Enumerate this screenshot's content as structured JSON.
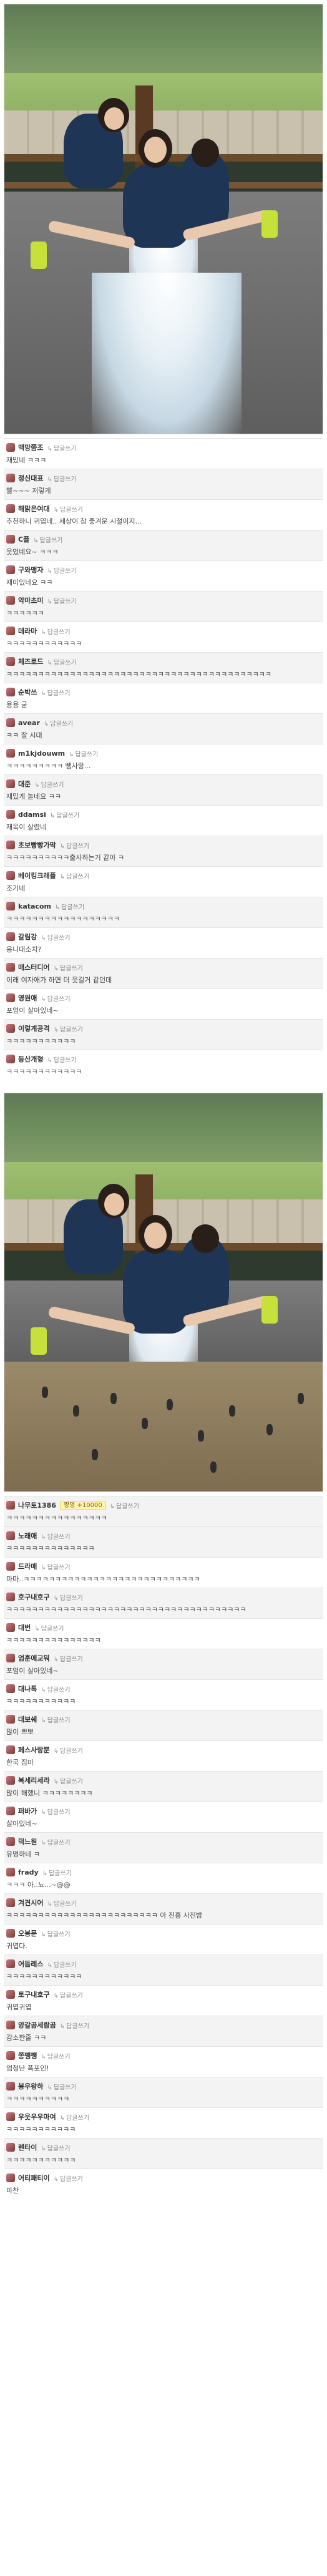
{
  "comments_top": [
    {
      "nick": "맥망쭘조",
      "reply": "답글쓰기",
      "text": "재밌네 ㅋㅋㅋ"
    },
    {
      "nick": "정신대표",
      "reply": "답글쓰기",
      "text": "빨~~~ 저렇게"
    },
    {
      "nick": "해맑은여대",
      "reply": "답글쓰기",
      "text": "추천하니 귀엽네.. 세상이 참 좋겨운 시절이지..."
    },
    {
      "nick": "C플",
      "reply": "답글쓰기",
      "text": "웃었네요~ ㅋㅋㅋ"
    },
    {
      "nick": "구와맹자",
      "reply": "답글쓰기",
      "text": "재미있네요 ㅋㅋ"
    },
    {
      "nick": "악마초미",
      "reply": "답글쓰기",
      "text": "ㅋㅋㅋㅋㅋㅋ"
    },
    {
      "nick": "데라마",
      "reply": "답글쓰기",
      "text": "ㅋㅋㅋㅋㅋㅋㅋㅋㅋㅋㅋㅋ"
    },
    {
      "nick": "체즈로드",
      "reply": "답글쓰기",
      "text": "ㅋㅋㅋㅋㅋㅋㅋㅋㅋㅋㅋㅋㅋㅋㅋㅋㅋㅋㅋㅋㅋㅋㅋㅋㅋㅋㅋㅋㅋㅋㅋㅋㅋㅋㅋㅋㅋㅋㅋㅋㅋㅋ"
    },
    {
      "nick": "순박쓰",
      "reply": "답글쓰기",
      "text": "용용 굳"
    },
    {
      "nick": "avear",
      "reply": "답글쓰기",
      "text": "ㅋㅋ 잘 시대"
    },
    {
      "nick": "m1kjdouwm",
      "reply": "답글쓰기",
      "text": "ㅋㅋㅋㅋㅋㅋㅋㅋㅋ 뺑사랑..."
    },
    {
      "nick": "대준",
      "reply": "답글쓰기",
      "text": "재밌게 놀네요 ㅋㅋ"
    },
    {
      "nick": "ddamsi",
      "reply": "답글쓰기",
      "text": "재목이 살렸네"
    },
    {
      "nick": "초보빵빵가막",
      "reply": "답글쓰기",
      "text": "ㅋㅋㅋㅋㅋㅋㅋㅋㅋㅋ출사하는거 같아 ㅋ"
    },
    {
      "nick": "베이킹크래플",
      "reply": "답글쓰기",
      "text": "조기네"
    },
    {
      "nick": "katacom",
      "reply": "답글쓰기",
      "text": "ㅋㅋㅋㅋㅋㅋㅋㅋㅋㅋㅋㅋㅋㅋㅋㅋㅋㅋ"
    },
    {
      "nick": "갈림강",
      "reply": "답글쓰기",
      "text": "응니대소치?"
    },
    {
      "nick": "매스터디어",
      "reply": "답글쓰기",
      "text": "이래 여자애가 하면 더 웃길거 같던데"
    },
    {
      "nick": "영원애",
      "reply": "답글쓰기",
      "text": "포엄이 살아있네~"
    },
    {
      "nick": "이렇게공격",
      "reply": "답글쓰기",
      "text": "ㅋㅋㅋㅋㅋㅋㅋㅋㅋㅋㅋ"
    },
    {
      "nick": "등산개형",
      "reply": "답글쓰기",
      "text": "ㅋㅋㅋㅋㅋㅋㅋㅋㅋㅋㅋㅋ"
    }
  ],
  "comments_bottom": [
    {
      "nick": "나무토1386",
      "reply": "답글쓰기",
      "badge": "짱명 +10000",
      "text": "ㅋㅋㅋㅋㅋㅋㅋㅋㅋㅋㅋㅋㅋㅋㅋㅋ"
    },
    {
      "nick": "노래애",
      "reply": "답글쓰기",
      "text": "ㅋㅋㅋㅋㅋㅋㅋㅋㅋㅋㅋㅋㅋㅋ"
    },
    {
      "nick": "드라매",
      "reply": "답글쓰기",
      "text": "마마..ㅋㅋㅋㅋㅋㅋㅋㅋㅋㅋㅋㅋㅋㅋㅋㅋㅋㅋㅋㅋㅋㅋㅋㅋㅋㅋㅋㅋ"
    },
    {
      "nick": "호구내호구",
      "reply": "답글쓰기",
      "text": "ㅋㅋㅋㅋㅋㅋㅋㅋㅋㅋㅋㅋㅋㅋㅋㅋㅋㅋㅋㅋㅋㅋㅋㅋㅋㅋㅋㅋㅋㅋㅋㅋㅋㅋㅋㅋㅋㅋ"
    },
    {
      "nick": "대번",
      "reply": "답글쓰기",
      "text": "ㅋㅋㅋㅋㅋㅋㅋㅋㅋㅋㅋㅋㅋㅋㅋ"
    },
    {
      "nick": "엄훈에교뭐",
      "reply": "답글쓰기",
      "text": "포엄이 살아있네~"
    },
    {
      "nick": "대나톡",
      "reply": "답글쓰기",
      "text": "ㅋㅋㅋㅋㅋㅋㅋㅋㅋㅋㅋ"
    },
    {
      "nick": "대보쉐",
      "reply": "답글쓰기",
      "text": "많이 쁘뽀"
    },
    {
      "nick": "페스사랑뿐",
      "reply": "답글쓰기",
      "text": "한국 집마"
    },
    {
      "nick": "복세리세라",
      "reply": "답글쓰기",
      "text": "많이 해했니 ㅋㅋㅋㅋㅋㅋㅋㅋ"
    },
    {
      "nick": "퍼바가",
      "reply": "답글쓰기",
      "text": "살아있네~"
    },
    {
      "nick": "덕느원",
      "reply": "답글쓰기",
      "text": "유명하네 ㅋ"
    },
    {
      "nick": "frady",
      "reply": "답글쓰기",
      "text": "ㅋㅋㅋ 아..뇨...~@@"
    },
    {
      "nick": "겨견시어",
      "reply": "답글쓰기",
      "text": "ㅋㅋㅋㅋㅋㅋㅋㅋㅋㅋㅋㅋㅋㅋㅋㅋㅋㅋㅋㅋㅋㅋㅋㅋ 아 진흥 사진밤"
    },
    {
      "nick": "오봉문",
      "reply": "답글쓰기",
      "text": "귀엽다."
    },
    {
      "nick": "어듬레스",
      "reply": "답글쓰기",
      "text": "ㅋㅋㅋㅋㅋㅋㅋㅋㅋㅋㅋㅋ"
    },
    {
      "nick": "토구내호구",
      "reply": "답글쓰기",
      "text": "귀엽귀엽"
    },
    {
      "nick": "양갈곰세람곰",
      "reply": "답글쓰기",
      "text": "감소한줄 ㅋㅋ"
    },
    {
      "nick": "쫑쨍쨍",
      "reply": "답글쓰기",
      "text": "엄청난 폭포인!"
    },
    {
      "nick": "봉우왕하",
      "reply": "답글쓰기",
      "text": "ㅋㅋㅋㅋㅋㅋㅋㅋㅋㅋ"
    },
    {
      "nick": "우웃우우마여",
      "reply": "답글쓰기",
      "text": "ㅋㅋㅋㅋㅋㅋㅋㅋㅋㅋㅋ"
    },
    {
      "nick": "렌타이",
      "reply": "답글쓰기",
      "text": "ㅋㅋㅋㅋㅋㅋㅋㅋㅋㅋㅋ"
    },
    {
      "nick": "어티패티이",
      "reply": "답글쓰기",
      "text": "마찬"
    }
  ]
}
